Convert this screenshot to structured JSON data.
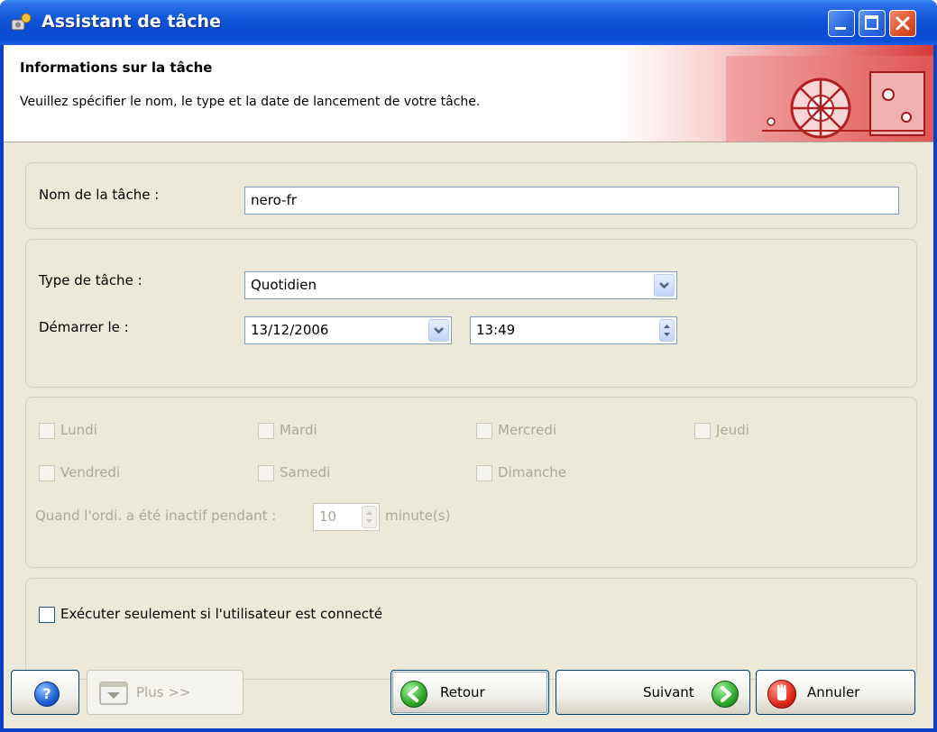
{
  "window": {
    "title": "Assistant de tâche"
  },
  "header": {
    "title": "Informations sur la tâche",
    "description": "Veuillez spécifier le nom, le type et la date de lancement de votre tâche."
  },
  "name_section": {
    "label": "Nom de la tâche :",
    "value": "nero-fr"
  },
  "type_section": {
    "type_label": "Type de tâche :",
    "type_value": "Quotidien",
    "start_label": "Démarrer le :",
    "start_date": "13/12/2006",
    "start_time": "13:49"
  },
  "days": {
    "monday": "Lundi",
    "tuesday": "Mardi",
    "wednesday": "Mercredi",
    "thursday": "Jeudi",
    "friday": "Vendredi",
    "saturday": "Samedi",
    "sunday": "Dimanche",
    "idle_label": "Quand l'ordi. a été inactif pendant :",
    "idle_value": "10",
    "idle_unit": "minute(s)"
  },
  "options": {
    "run_if_logged_on": "Exécuter seulement si l'utilisateur est connecté"
  },
  "buttons": {
    "help": "?",
    "more": "Plus >>",
    "back": "Retour",
    "next": "Suivant",
    "cancel": "Annuler"
  }
}
